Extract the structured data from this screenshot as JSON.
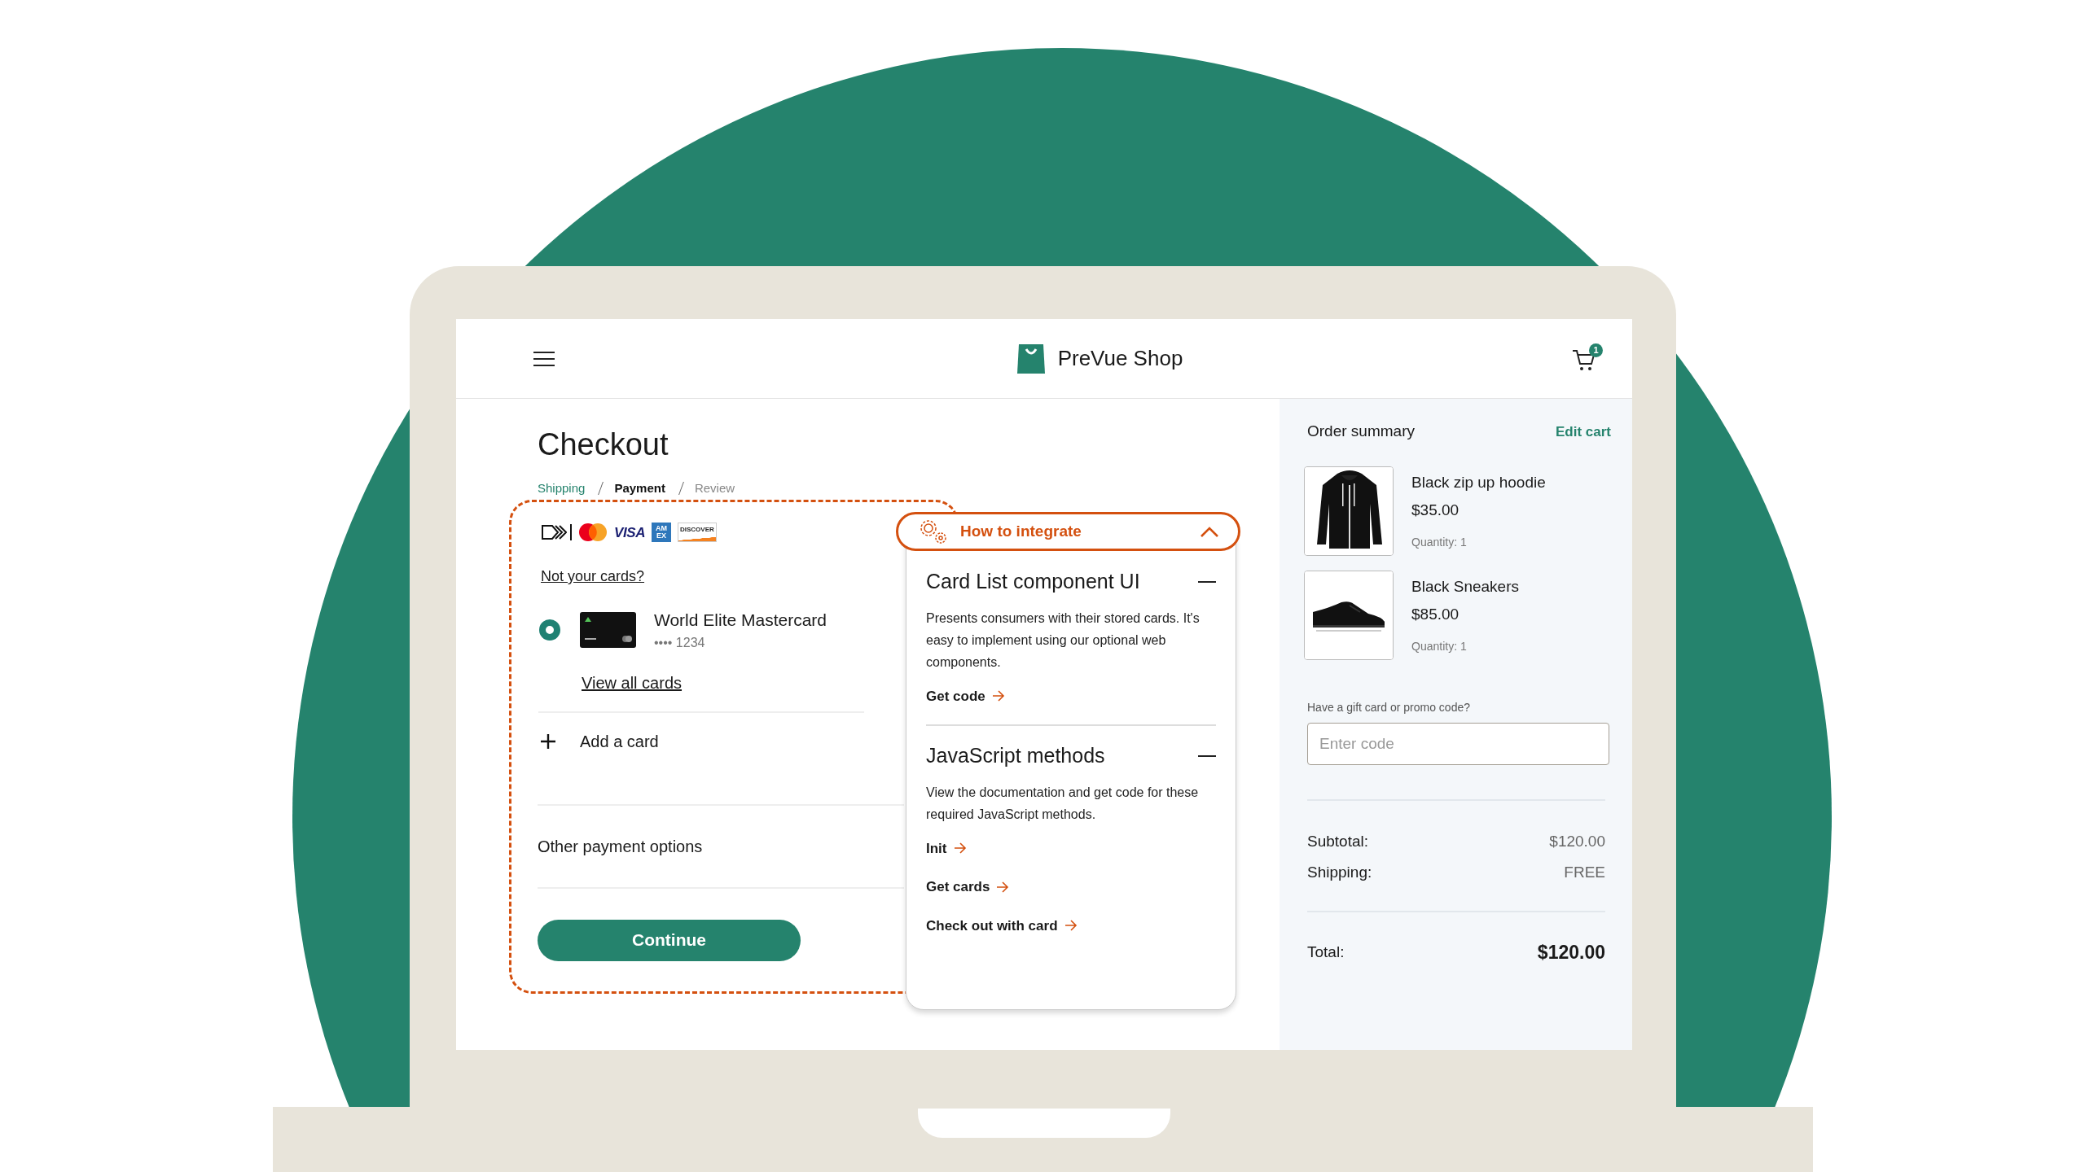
{
  "header": {
    "brand": "PreVue Shop",
    "cart_count": "1"
  },
  "checkout": {
    "title": "Checkout",
    "breadcrumb": [
      {
        "label": "Shipping",
        "kind": "done"
      },
      {
        "label": "Payment",
        "kind": "current"
      },
      {
        "label": "Review",
        "kind": "upcoming"
      }
    ],
    "accepted_cards": [
      {
        "kind": "click_to_pay"
      },
      {
        "kind": "mastercard"
      },
      {
        "kind": "visa",
        "label": "VISA"
      },
      {
        "kind": "amex",
        "label": "AM EX"
      },
      {
        "kind": "discover",
        "label": "DISCOVER"
      }
    ],
    "not_your_cards": "Not your cards?",
    "cards": [
      {
        "name": "World Elite Mastercard",
        "number": "•••• 1234",
        "selected": true
      }
    ],
    "view_all": "View all cards",
    "add_card": "Add a card",
    "other_options": "Other payment options",
    "continue": "Continue"
  },
  "integrate": {
    "title": "How to integrate",
    "expanded": true,
    "sections": [
      {
        "title": "Card List component UI",
        "expanded": true,
        "description": "Presents consumers with their stored cards. It's easy to implement using our optional web components.",
        "links": [
          "Get code"
        ]
      },
      {
        "title": "JavaScript methods",
        "expanded": true,
        "description": "View the documentation and get code for these required JavaScript methods.",
        "links": [
          "Init",
          "Get cards",
          "Check out with card"
        ]
      }
    ]
  },
  "summary": {
    "title": "Order summary",
    "edit": "Edit cart",
    "items": [
      {
        "kind": "hoodie",
        "name": "Black zip up hoodie",
        "price": "$35.00",
        "quantity": "Quantity: 1"
      },
      {
        "kind": "sneakers",
        "name": "Black Sneakers",
        "price": "$85.00",
        "quantity": "Quantity: 1"
      }
    ],
    "promo": {
      "label": "Have a gift card or promo code?",
      "placeholder": "Enter code"
    },
    "totals": [
      {
        "label": "Subtotal:",
        "value": "$120.00",
        "kind": "line"
      },
      {
        "label": "Shipping:",
        "value": "FREE",
        "kind": "line"
      },
      {
        "label": "Total:",
        "value": "$120.00",
        "kind": "total"
      }
    ]
  }
}
